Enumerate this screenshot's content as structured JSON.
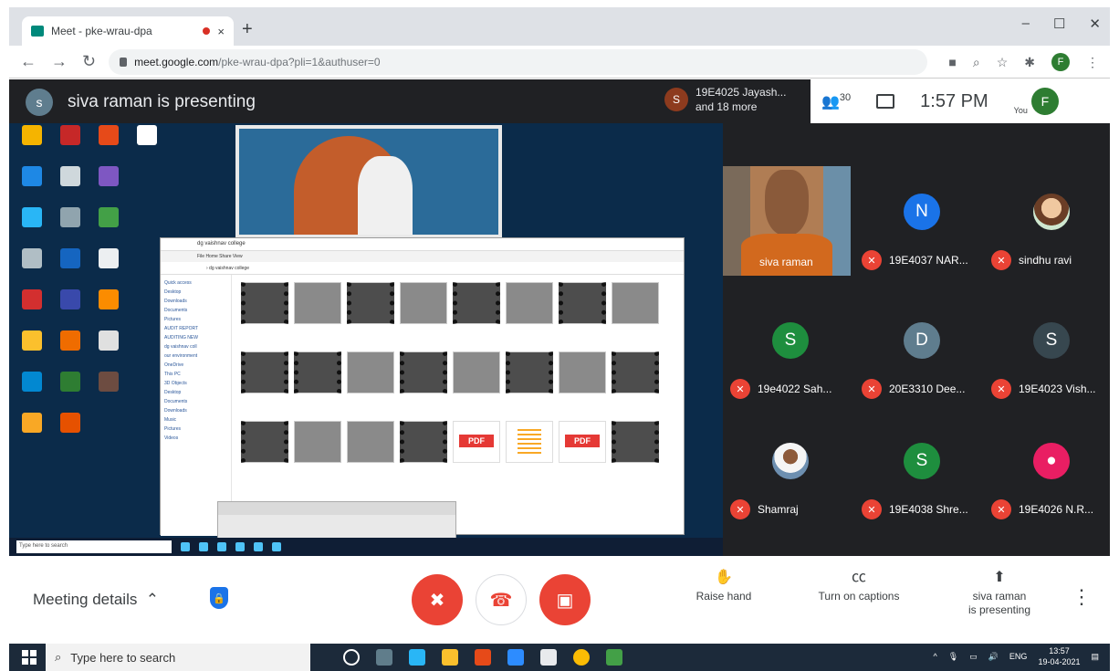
{
  "browser": {
    "tab_title": "Meet - pke-wrau-dpa",
    "tab_close": "×",
    "new_tab": "+",
    "url_host": "meet.google.com",
    "url_path": "/pke-wrau-dpa?pli=1&authuser=0",
    "profile_initial": "F",
    "window_controls": [
      "–",
      "☐",
      "✕"
    ]
  },
  "meet": {
    "presenter_initial": "s",
    "presenting_text": "siva raman is presenting",
    "also_initial": "S",
    "also_line1": "19E4025 Jayash...",
    "also_line2": "and 18 more",
    "people_count": "30",
    "clock": "1:57 PM",
    "you_label": "You",
    "you_initial": "F"
  },
  "participants": [
    {
      "name": "siva raman",
      "type": "video"
    },
    {
      "name": "19E4037 NAR...",
      "initial": "N",
      "color": "#1a73e8"
    },
    {
      "name": "sindhu ravi",
      "type": "photo"
    },
    {
      "name": "19e4022 Sah...",
      "initial": "S",
      "color": "#1e8e3e"
    },
    {
      "name": "20E3310 Dee...",
      "initial": "D",
      "color": "#5f7d8e"
    },
    {
      "name": "19E4023 Vish...",
      "initial": "S",
      "color": "#37474f"
    },
    {
      "name": "Shamraj",
      "type": "photo"
    },
    {
      "name": "19E4038 Shre...",
      "initial": "S",
      "color": "#1e8e3e"
    },
    {
      "name": "19E4026 N.R...",
      "initial": "person",
      "color": "#e91e63"
    }
  ],
  "shared_screen": {
    "explorer_title": "dg vaishnav college",
    "ribbon": "File   Home   Share   View",
    "address": "›  dg vaishnav college",
    "nav_items": [
      "Quick access",
      "Desktop",
      "Downloads",
      "Documents",
      "Pictures",
      "AUDIT REPORT",
      "AUDITING NEW",
      "dg vaishnav coll",
      "our environment",
      "OneDrive",
      "This PC",
      "3D Objects",
      "Desktop",
      "Documents",
      "Downloads",
      "Music",
      "Pictures",
      "Videos"
    ],
    "pdf_label": "PDF",
    "inner_search": "Type here to search"
  },
  "controls": {
    "meeting_details": "Meeting details",
    "raise_hand": "Raise hand",
    "captions": "Turn on captions",
    "presenter_line1": "siva raman",
    "presenter_line2": "is presenting"
  },
  "taskbar": {
    "search_placeholder": "Type here to search",
    "lang": "ENG",
    "time": "13:57",
    "date": "19-04-2021"
  }
}
